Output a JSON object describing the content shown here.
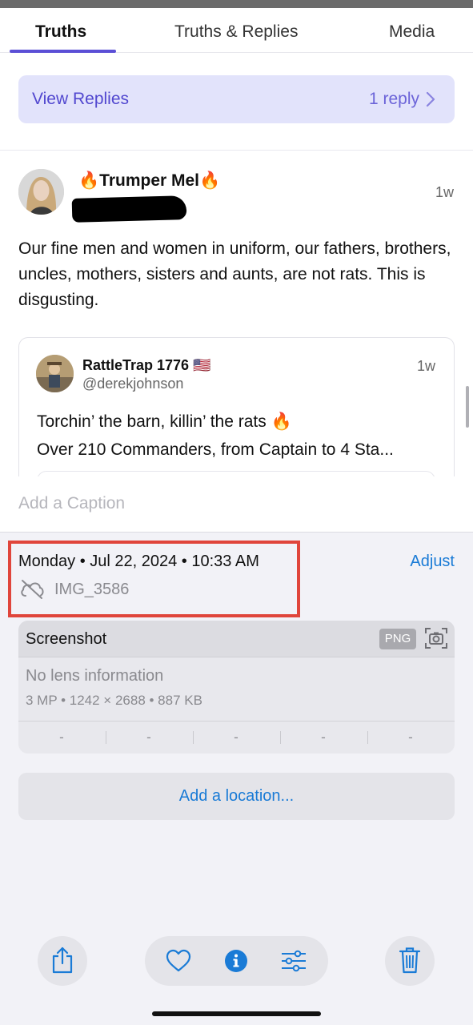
{
  "tabs": [
    {
      "label": "Truths",
      "active": true
    },
    {
      "label": "Truths & Replies",
      "active": false
    },
    {
      "label": "Media",
      "active": false
    }
  ],
  "view_replies": {
    "label": "View Replies",
    "count": "1 reply"
  },
  "post": {
    "author": "🔥Trumper Mel🔥",
    "time": "1w",
    "text": "Our fine men and women in uniform, our fathers, brothers, uncles, mothers, sisters and aunts, are not rats. This is disgusting."
  },
  "quote": {
    "name": "RattleTrap 1776 🇺🇸",
    "handle": "@derekjohnson",
    "time": "1w",
    "line1": "Torchin’ the barn, killin’ the rats 🔥",
    "line2": "Over 210 Commanders, from Captain to 4 Sta..."
  },
  "photo_info": {
    "caption_placeholder": "Add a Caption",
    "datetime": "Monday • Jul 22, 2024 • 10:33 AM",
    "adjust_label": "Adjust",
    "filename": "IMG_3586",
    "type_title": "Screenshot",
    "format_badge": "PNG",
    "lens": "No lens information",
    "meta": "3 MP • 1242 × 2688 • 887 KB",
    "exif": [
      "-",
      "-",
      "-",
      "-",
      "-"
    ],
    "location_label": "Add a location..."
  },
  "colors": {
    "accent_purple": "#5b4fd6",
    "ios_blue": "#1a7bd6",
    "highlight_red": "#e0453b"
  },
  "toolbar_icons": [
    "share-icon",
    "heart-icon",
    "info-icon",
    "adjust-sliders-icon",
    "trash-icon"
  ]
}
